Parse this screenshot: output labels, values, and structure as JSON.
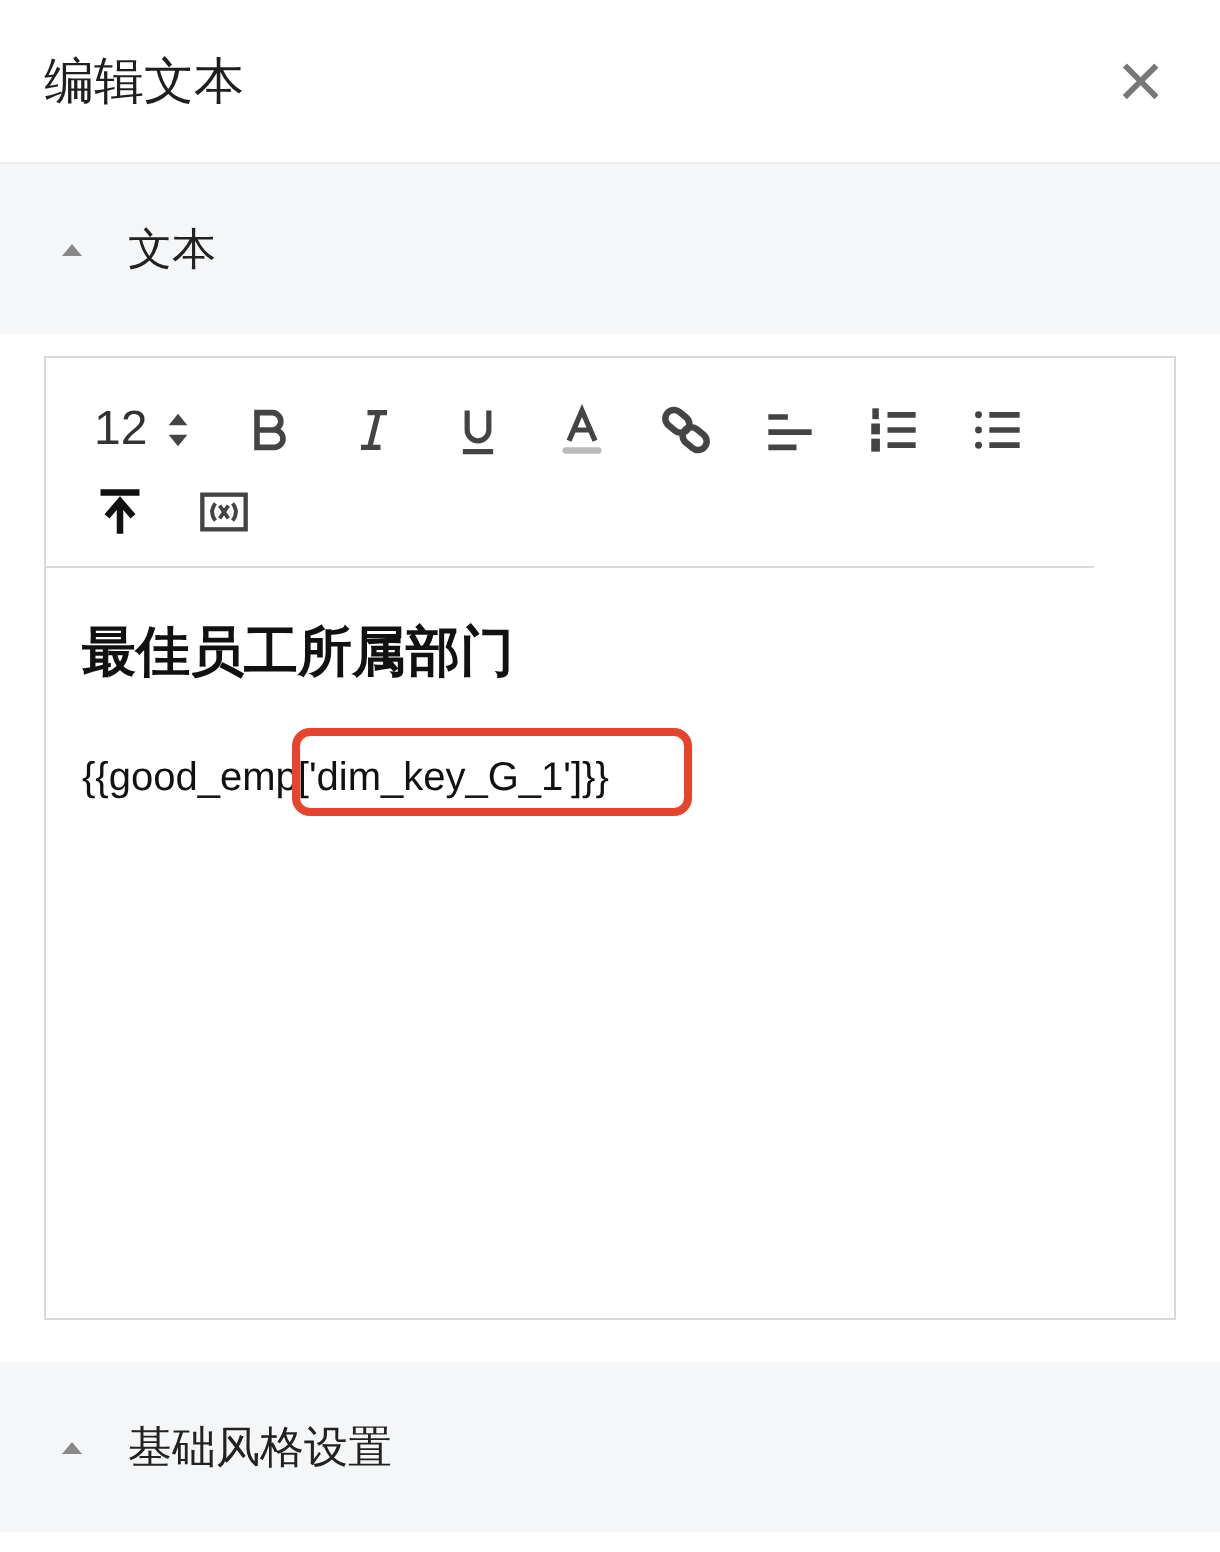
{
  "panel": {
    "title": "编辑文本",
    "close": "×"
  },
  "sections": [
    {
      "title": "文本",
      "expanded": true
    },
    {
      "title": "基础风格设置",
      "expanded": true
    }
  ],
  "editor": {
    "font_size": "12",
    "tools": [
      {
        "kind": "stepper"
      },
      {
        "kind": "bold"
      },
      {
        "kind": "italic"
      },
      {
        "kind": "underline"
      },
      {
        "kind": "color"
      },
      {
        "kind": "link"
      },
      {
        "kind": "align"
      },
      {
        "kind": "ordered"
      },
      {
        "kind": "bullet"
      },
      {
        "kind": "top"
      },
      {
        "kind": "variable"
      }
    ],
    "heading": "最佳员工所属部门",
    "body": "{{good_emp['dim_key_G_1']}}",
    "highlighted": true
  }
}
